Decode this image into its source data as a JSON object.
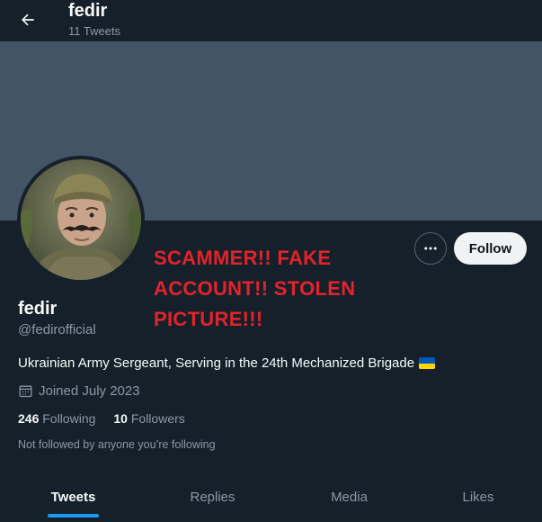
{
  "header": {
    "title": "fedir",
    "subtitle": "11 Tweets",
    "back_icon": "arrow-left-icon"
  },
  "profile": {
    "name": "fedir",
    "handle": "@fedirofficial",
    "bio": "Ukrainian Army Sergeant, Serving in the 24th  Mechanized Brigade",
    "joined": "Joined July 2023",
    "following_count": "246",
    "following_label": "Following",
    "followers_count": "10",
    "followers_label": "Followers",
    "not_followed": "Not followed by anyone you’re following"
  },
  "actions": {
    "more_icon": "ellipsis-icon",
    "follow_label": "Follow"
  },
  "annotation": {
    "lines": [
      "SCAMMER!! FAKE",
      "ACCOUNT!! STOLEN",
      "PICTURE!!!"
    ],
    "color": "#e3232a"
  },
  "tabs": [
    {
      "label": "Tweets",
      "active": true
    },
    {
      "label": "Replies",
      "active": false
    },
    {
      "label": "Media",
      "active": false
    },
    {
      "label": "Likes",
      "active": false
    }
  ],
  "colors": {
    "background": "#15202b",
    "banner": "#425466",
    "accent": "#1d9bf0",
    "muted": "#8b98a5",
    "flag_blue": "#0057b7",
    "flag_yellow": "#ffd700"
  }
}
